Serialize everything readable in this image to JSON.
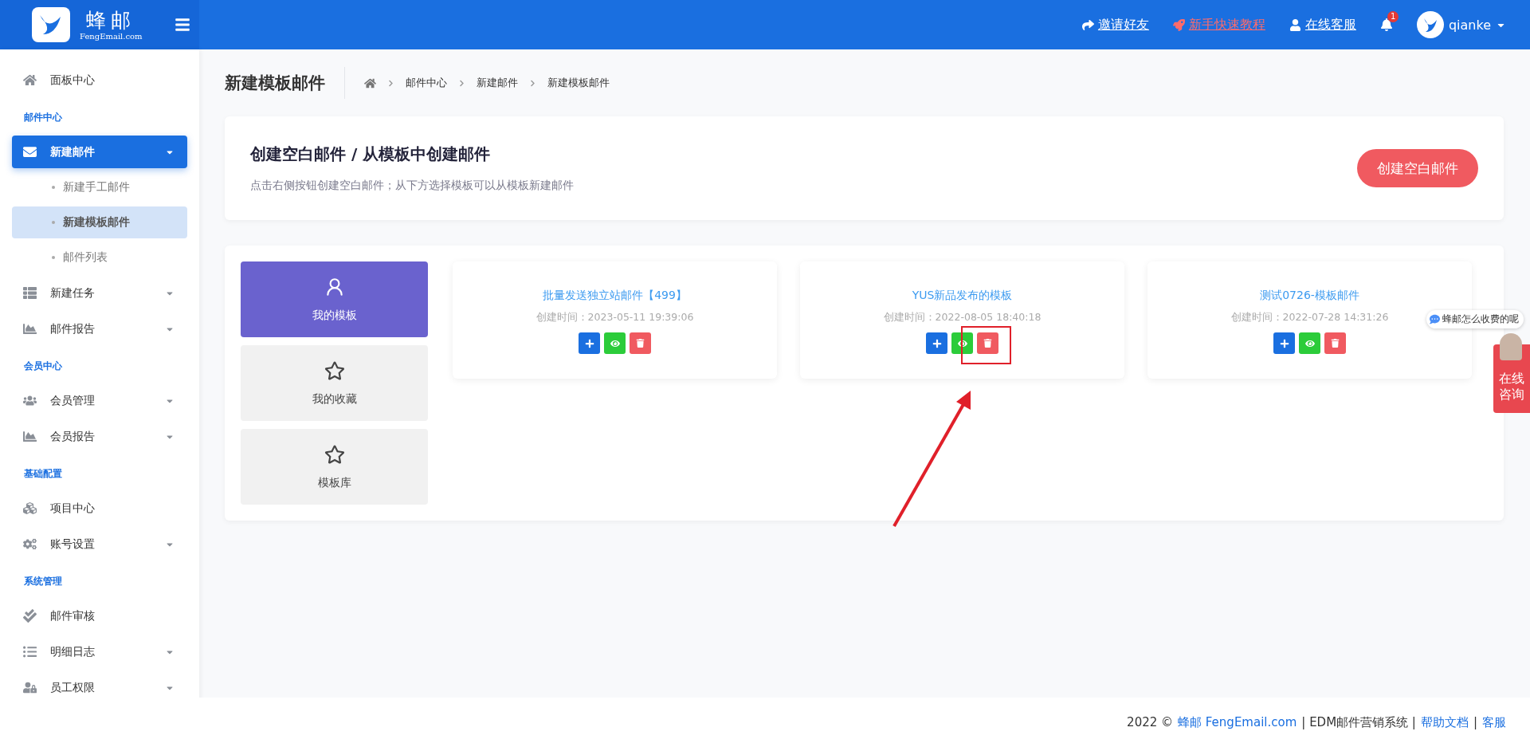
{
  "header": {
    "logo_title": "蜂邮",
    "logo_subtitle": "FengEmail.com",
    "links": [
      {
        "label": "邀请好友",
        "kind": "invite"
      },
      {
        "label": "新手快速教程",
        "kind": "tutorial"
      },
      {
        "label": "在线客服",
        "kind": "support"
      }
    ],
    "notification_count": "1",
    "user": "qianke"
  },
  "sidebar": [
    {
      "kind": "item",
      "label": "面板中心",
      "selected": false,
      "expandable": false
    },
    {
      "kind": "heading",
      "label": "邮件中心"
    },
    {
      "kind": "item",
      "label": "新建邮件",
      "selected": true,
      "expandable": true,
      "children": [
        {
          "label": "新建手工邮件",
          "selected": false
        },
        {
          "label": "新建模板邮件",
          "selected": true
        },
        {
          "label": "邮件列表",
          "selected": false
        }
      ]
    },
    {
      "kind": "item",
      "label": "新建任务",
      "selected": false,
      "expandable": true
    },
    {
      "kind": "item",
      "label": "邮件报告",
      "selected": false,
      "expandable": true
    },
    {
      "kind": "heading",
      "label": "会员中心"
    },
    {
      "kind": "item",
      "label": "会员管理",
      "selected": false,
      "expandable": true
    },
    {
      "kind": "item",
      "label": "会员报告",
      "selected": false,
      "expandable": true
    },
    {
      "kind": "heading",
      "label": "基础配置"
    },
    {
      "kind": "item",
      "label": "项目中心",
      "selected": false,
      "expandable": false
    },
    {
      "kind": "item",
      "label": "账号设置",
      "selected": false,
      "expandable": true
    },
    {
      "kind": "heading",
      "label": "系统管理"
    },
    {
      "kind": "item",
      "label": "邮件审核",
      "selected": false,
      "expandable": false
    },
    {
      "kind": "item",
      "label": "明细日志",
      "selected": false,
      "expandable": true
    },
    {
      "kind": "item",
      "label": "员工权限",
      "selected": false,
      "expandable": true
    }
  ],
  "page": {
    "title": "新建模板邮件",
    "breadcrumb": [
      "邮件中心",
      "新建邮件",
      "新建模板邮件"
    ]
  },
  "intro": {
    "title": "创建空白邮件 / 从模板中创建邮件",
    "description": "点击右侧按钮创建空白邮件；从下方选择模板可以从模板新建邮件",
    "button": "创建空白邮件"
  },
  "template_tabs": [
    {
      "label": "我的模板",
      "selected": true
    },
    {
      "label": "我的收藏",
      "selected": false
    },
    {
      "label": "模板库",
      "selected": false
    }
  ],
  "templates": [
    {
      "name": "批量发送独立站邮件【499】",
      "created": "创建时间：2023-05-11 19:39:06",
      "highlighted": false
    },
    {
      "name": "YUS新品发布的模板",
      "created": "创建时间：2022-08-05 18:40:18",
      "highlighted": true
    },
    {
      "name": "测试0726-模板邮件",
      "created": "创建时间：2022-07-28 14:31:26",
      "highlighted": false
    }
  ],
  "chat_widget": {
    "bubble": "蜂邮怎么收费的呢",
    "tab": "在线咨询"
  },
  "footer": [
    {
      "text": "2022 ©",
      "kind": "plain"
    },
    {
      "text": "蜂邮 FengEmail.com",
      "kind": "link"
    },
    {
      "text": "| EDM邮件营销系统 |",
      "kind": "plain"
    },
    {
      "text": "帮助文档",
      "kind": "link"
    },
    {
      "text": "|",
      "kind": "plain"
    },
    {
      "text": "客服",
      "kind": "link"
    }
  ]
}
